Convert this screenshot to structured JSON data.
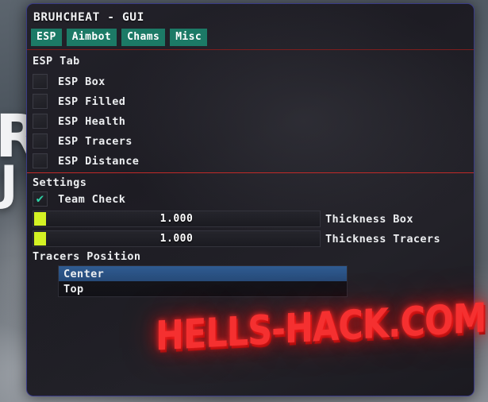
{
  "background": {
    "overlay_letters_line1": "RI",
    "overlay_letters_line2": "J"
  },
  "panel": {
    "title": "BRUHCHEAT - GUI",
    "border_color": "#3a3b86",
    "tabs": [
      {
        "label": "ESP",
        "active": true
      },
      {
        "label": "Aimbot",
        "active": false
      },
      {
        "label": "Chams",
        "active": false
      },
      {
        "label": "Misc",
        "active": false
      }
    ],
    "tab_color": "#1c7a66",
    "sections": {
      "esp": {
        "heading": "ESP Tab",
        "checkboxes": [
          {
            "label": "ESP Box",
            "checked": false
          },
          {
            "label": "ESP Filled",
            "checked": false
          },
          {
            "label": "ESP Health",
            "checked": false
          },
          {
            "label": "ESP Tracers",
            "checked": false
          },
          {
            "label": "ESP Distance",
            "checked": false
          }
        ]
      },
      "settings": {
        "heading": "Settings",
        "checkboxes": [
          {
            "label": "Team Check",
            "checked": true,
            "check_glyph": "✔",
            "check_color": "#2ecfa4"
          }
        ],
        "sliders": [
          {
            "label": "Thickness Box",
            "value": "1.000",
            "fill_color": "#d4f224"
          },
          {
            "label": "Thickness Tracers",
            "value": "1.000",
            "fill_color": "#d4f224"
          }
        ]
      },
      "tracers_position": {
        "heading": "Tracers Position",
        "options": [
          {
            "label": "Center",
            "selected": true
          },
          {
            "label": "Top",
            "selected": false
          }
        ],
        "selected_value": "Center",
        "highlight_color": "#2f5b91"
      }
    },
    "separator_colors": {
      "top": "#7e1d1d",
      "middle": "#c12a28"
    }
  },
  "watermark": {
    "text": "HELLS-HACK.COM",
    "color": "#f53030"
  }
}
